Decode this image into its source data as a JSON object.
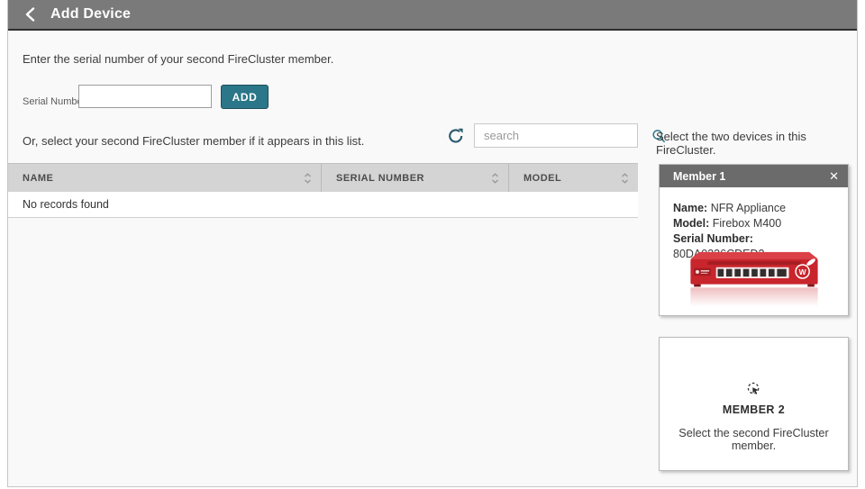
{
  "header": {
    "title": "Add Device"
  },
  "serial_section": {
    "instruction": "Enter the serial number of your second FireCluster member.",
    "label": "Serial Number",
    "input_value": "",
    "add_button": "ADD"
  },
  "list_section": {
    "or_text": "Or, select your second FireCluster member if it appears in this list.",
    "search_placeholder": "search",
    "table": {
      "columns": {
        "name": "NAME",
        "serial": "SERIAL NUMBER",
        "model": "MODEL"
      },
      "empty_text": "No records found"
    }
  },
  "cluster_panel": {
    "instruction": "Select the two devices in this FireCluster.",
    "member1": {
      "title": "Member 1",
      "close_icon": "✕",
      "name_label": "Name:",
      "name_value": " NFR Appliance",
      "model_label": "Model:",
      "model_value": " Firebox M400",
      "serial_label": "Serial Number:",
      "serial_value": " 80DA0336CDED2",
      "device_image": "firebox-m400-red-appliance"
    },
    "member2": {
      "title": "MEMBER 2",
      "description": "Select the second FireCluster member."
    }
  },
  "colors": {
    "accent_teal": "#2b7689",
    "topbar_gray": "#7a7a7a",
    "table_header_bg": "#d4d4d4",
    "member_header_gray": "#6b6b6b",
    "device_red": "#c8252c"
  }
}
